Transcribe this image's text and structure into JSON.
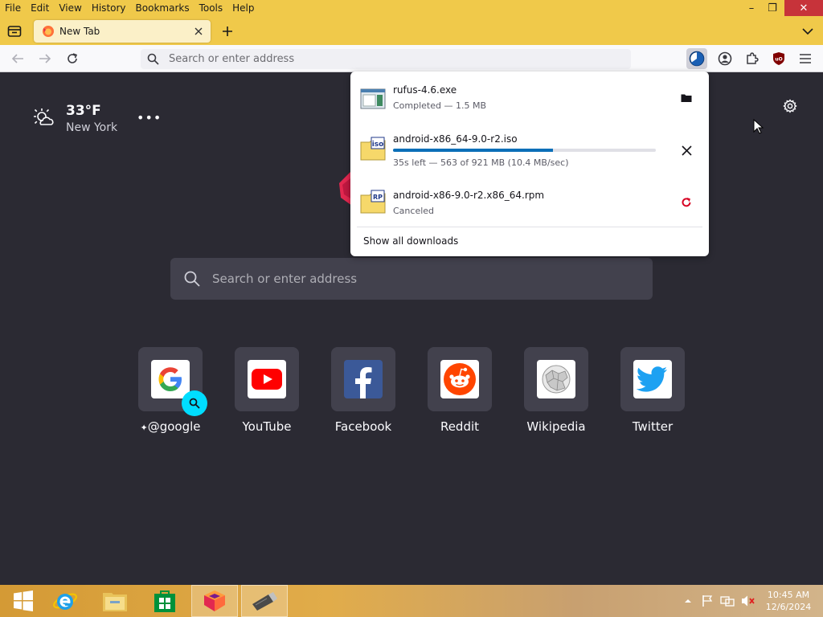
{
  "menubar": {
    "items": [
      "File",
      "Edit",
      "View",
      "History",
      "Bookmarks",
      "Tools",
      "Help"
    ]
  },
  "window_controls": {
    "minimize": "–",
    "restore": "❐",
    "close": "✕"
  },
  "tabs": [
    {
      "title": "New Tab",
      "favicon": "firefox-icon"
    }
  ],
  "urlbar": {
    "placeholder": "Search or enter address"
  },
  "weather": {
    "temperature": "33°F",
    "city": "New York",
    "icon": "partly-sunny-icon"
  },
  "content_search": {
    "placeholder": "Search or enter address"
  },
  "top_sites": [
    {
      "label": "@google",
      "icon": "google-icon"
    },
    {
      "label": "YouTube",
      "icon": "youtube-icon"
    },
    {
      "label": "Facebook",
      "icon": "facebook-icon"
    },
    {
      "label": "Reddit",
      "icon": "reddit-icon"
    },
    {
      "label": "Wikipedia",
      "icon": "wikipedia-icon"
    },
    {
      "label": "Twitter",
      "icon": "twitter-icon"
    }
  ],
  "downloads": {
    "items": [
      {
        "name": "rufus-4.6.exe",
        "status": "Completed — 1.5 MB",
        "action": "folder-icon",
        "icon": "exe-file-icon"
      },
      {
        "name": "android-x86_64-9.0-r2.iso",
        "status": "35s left — 563 of 921 MB (10.4 MB/sec)",
        "progress": 0.61,
        "action": "cancel-icon",
        "icon": "iso-file-icon"
      },
      {
        "name": "android-x86-9.0-r2.x86_64.rpm",
        "status": "Canceled",
        "action": "retry-icon",
        "icon": "rpm-file-icon"
      }
    ],
    "show_all": "Show all downloads",
    "progress_color": "#0b6fb8"
  },
  "taskbar": {
    "apps": [
      "start-icon",
      "internet-explorer-icon",
      "file-explorer-icon",
      "store-icon",
      "firefox-icon",
      "usb-drive-icon"
    ],
    "clock": {
      "time": "10:45 AM",
      "date": "12/6/2024"
    }
  },
  "colors": {
    "chrome_yellow": "#f0c94a",
    "page_bg": "#2b2a33",
    "tile_bg": "#42414d"
  }
}
